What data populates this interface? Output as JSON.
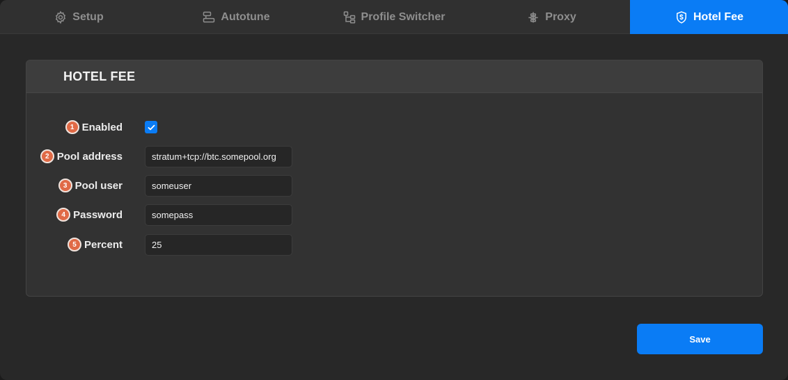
{
  "tabs": [
    {
      "label": "Setup",
      "icon": "gear-icon"
    },
    {
      "label": "Autotune",
      "icon": "autotune-icon"
    },
    {
      "label": "Profile Switcher",
      "icon": "profile-switcher-icon"
    },
    {
      "label": "Proxy",
      "icon": "proxy-icon"
    },
    {
      "label": "Hotel Fee",
      "icon": "shield-dollar-icon",
      "active": true
    }
  ],
  "panel": {
    "title": "HOTEL FEE"
  },
  "form": {
    "enabled": {
      "badge": "1",
      "label": "Enabled",
      "checked": true
    },
    "pool_address": {
      "badge": "2",
      "label": "Pool address",
      "value": "stratum+tcp://btc.somepool.org"
    },
    "pool_user": {
      "badge": "3",
      "label": "Pool user",
      "value": "someuser"
    },
    "password": {
      "badge": "4",
      "label": "Password",
      "value": "somepass"
    },
    "percent": {
      "badge": "5",
      "label": "Percent",
      "value": "25"
    }
  },
  "actions": {
    "save_label": "Save"
  },
  "colors": {
    "accent": "#0a7cf5",
    "badge": "#e06a46",
    "background": "#282828"
  }
}
